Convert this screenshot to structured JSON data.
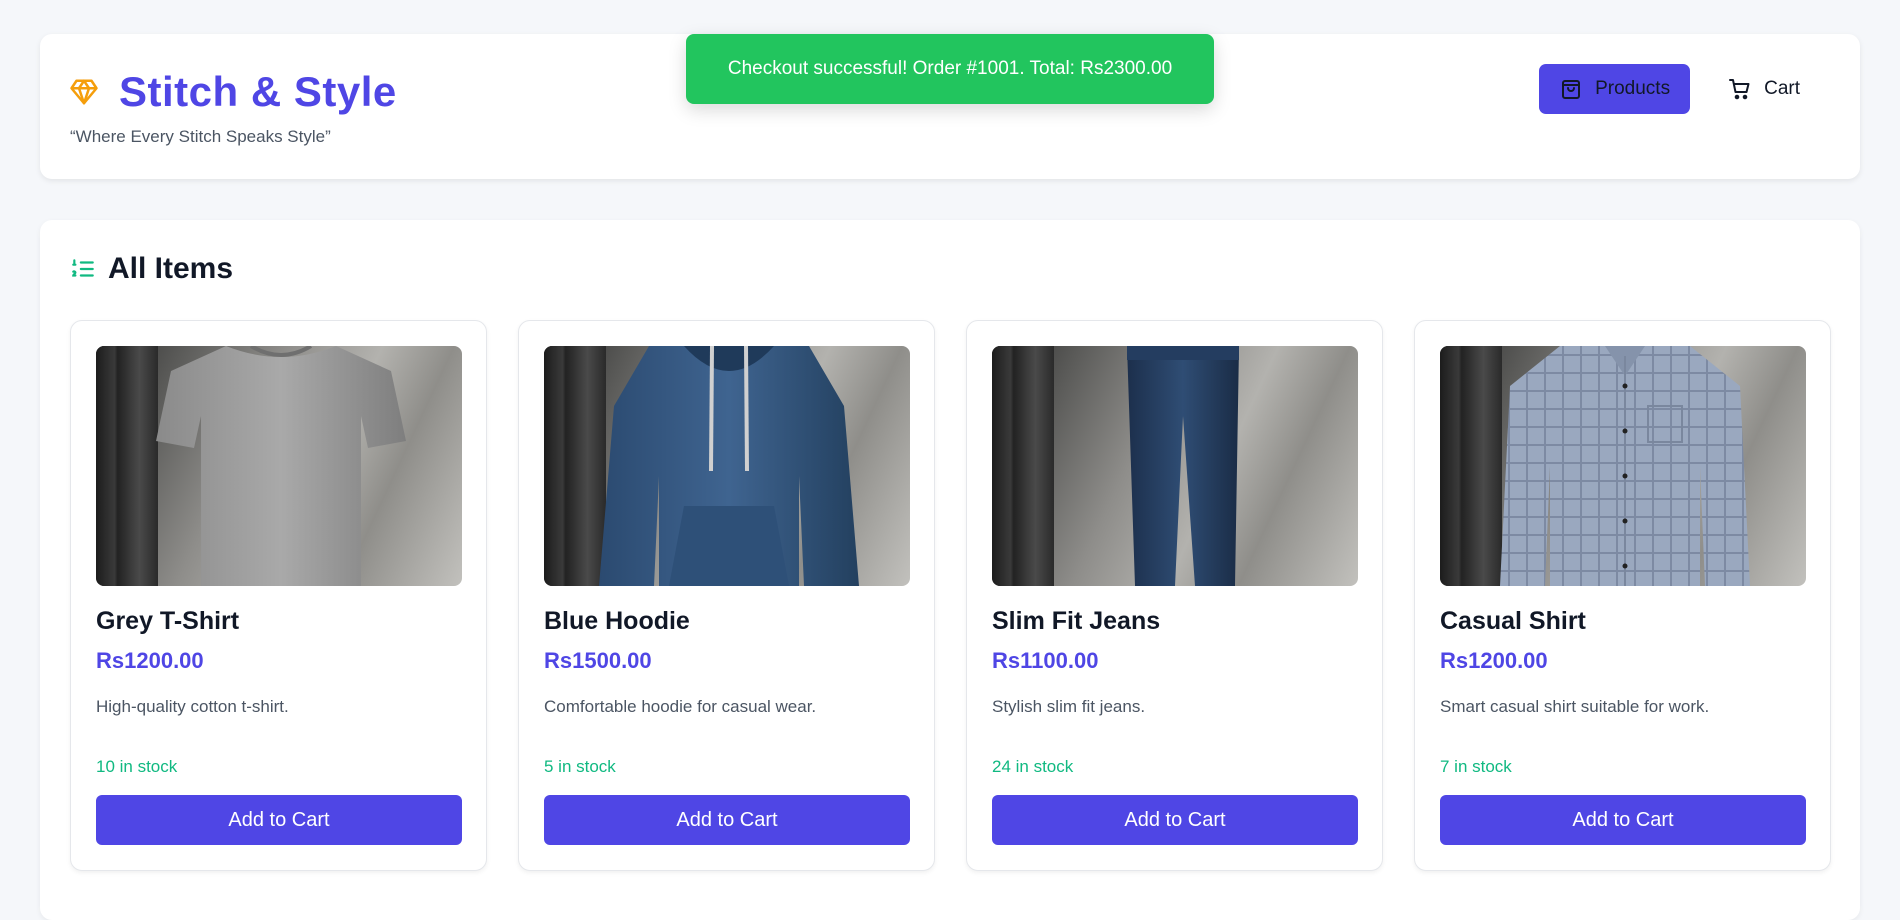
{
  "brand": {
    "title": "Stitch & Style",
    "tagline": "“Where Every Stitch Speaks Style”",
    "icon": "gem-icon"
  },
  "nav": {
    "products_label": "Products",
    "cart_label": "Cart"
  },
  "toast": {
    "message": "Checkout successful! Order #1001. Total: Rs2300.00"
  },
  "section": {
    "title": "All Items",
    "icon": "list-ordered-icon"
  },
  "products": [
    {
      "name": "Grey T-Shirt",
      "price": "Rs1200.00",
      "description": "High-quality cotton t-shirt.",
      "stock": "10 in stock",
      "button": "Add to Cart"
    },
    {
      "name": "Blue Hoodie",
      "price": "Rs1500.00",
      "description": "Comfortable hoodie for casual wear.",
      "stock": "5 in stock",
      "button": "Add to Cart"
    },
    {
      "name": "Slim Fit Jeans",
      "price": "Rs1100.00",
      "description": "Stylish slim fit jeans.",
      "stock": "24 in stock",
      "button": "Add to Cart"
    },
    {
      "name": "Casual Shirt",
      "price": "Rs1200.00",
      "description": "Smart casual shirt suitable for work.",
      "stock": "7 in stock",
      "button": "Add to Cart"
    }
  ],
  "colors": {
    "accent": "#4f46e5",
    "success": "#22c55e",
    "stock": "#10b981",
    "brand_icon": "#f59e0b"
  }
}
